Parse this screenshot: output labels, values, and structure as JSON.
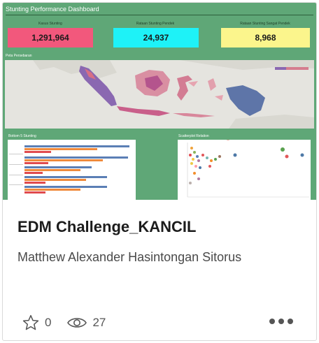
{
  "thumbnail": {
    "dashboard_title": "Stunting Performance Dashboard",
    "kpis": [
      {
        "label": "Kasus Stunting",
        "value": "1,291,964",
        "color": "#f2587c"
      },
      {
        "label": "Rataan Stunting Pendek",
        "value": "24,937",
        "color": "#1ef2f7"
      },
      {
        "label": "Rataan Stunting Sangat Pendek",
        "value": "8,968",
        "color": "#fbf58c"
      }
    ],
    "map_title": "Peta Persebaran",
    "bottom_left_title": "Bottom 5 Stunting",
    "bottom_right_title": "Scatterplot Relation"
  },
  "card": {
    "title": "EDM Challenge_KANCIL",
    "author": "Matthew Alexander Hasintongan Sitorus",
    "favorites_count": "0",
    "views_count": "27"
  },
  "icons": {
    "favorite": "star-outline-icon",
    "views": "eye-icon",
    "more": "more-horizontal-icon"
  }
}
